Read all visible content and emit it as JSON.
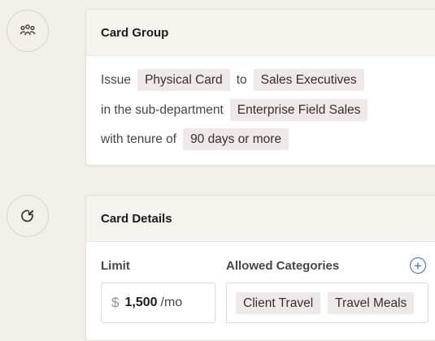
{
  "card_group": {
    "title": "Card Group",
    "issue_label": "Issue",
    "card_type": "Physical Card",
    "to_label": "to",
    "recipient": "Sales Executives",
    "subdept_label": "in the sub-department",
    "subdept": "Enterprise Field Sales",
    "tenure_label": "with tenure of",
    "tenure": "90 days or more",
    "icon": "people-group-icon"
  },
  "card_details": {
    "title": "Card Details",
    "icon": "pie-chart-icon",
    "limit_label": "Limit",
    "currency": "$",
    "limit_value": "1,500",
    "limit_period": "/mo",
    "categories_label": "Allowed Categories",
    "add_icon": "plus-circle-icon",
    "add_symbol": "+",
    "categories": [
      "Client Travel",
      "Travel Meals"
    ]
  },
  "colors": {
    "background": "#f2f0e8",
    "chip": "#efe8e8",
    "accent": "#3a69b0"
  }
}
